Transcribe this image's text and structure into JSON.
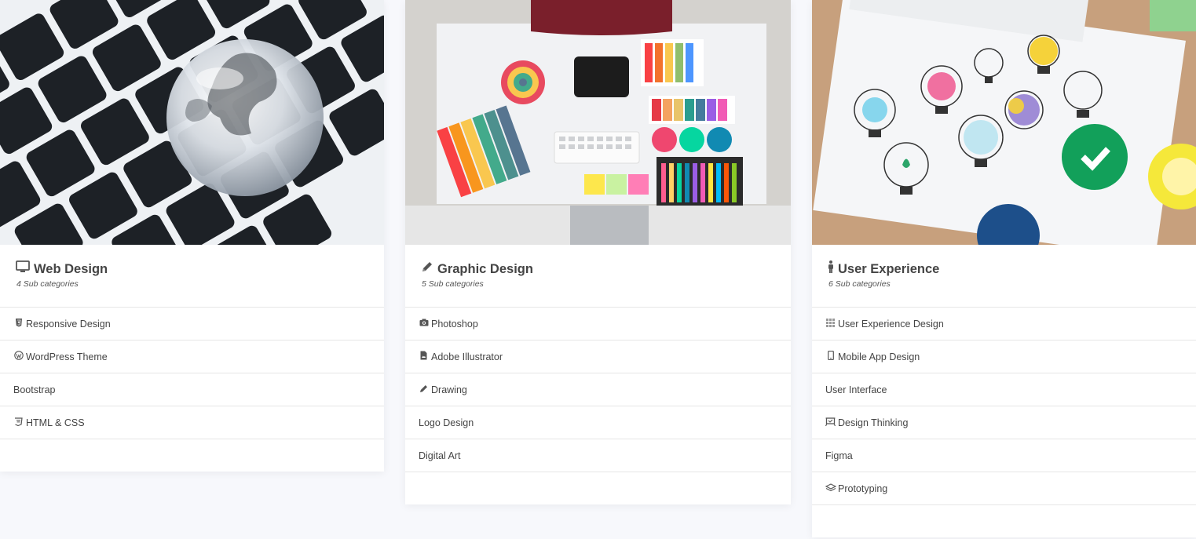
{
  "cards": [
    {
      "title": "Web Design",
      "icon": "monitor-icon",
      "subtitle": "4 Sub categories",
      "image": "keyboard-with-glass-globe",
      "items": [
        {
          "label": "Responsive Design",
          "icon": "html5-shield-icon"
        },
        {
          "label": "WordPress Theme",
          "icon": "wordpress-icon"
        },
        {
          "label": "Bootstrap",
          "icon": ""
        },
        {
          "label": "HTML & CSS",
          "icon": "css3-icon"
        }
      ]
    },
    {
      "title": "Graphic Design",
      "icon": "pencil-icon",
      "subtitle": "5 Sub categories",
      "image": "designer-desk-with-color-swatches",
      "items": [
        {
          "label": "Photoshop",
          "icon": "camera-icon"
        },
        {
          "label": "Adobe Illustrator",
          "icon": "file-image-icon"
        },
        {
          "label": "Drawing",
          "icon": "pencil-icon"
        },
        {
          "label": "Logo Design",
          "icon": ""
        },
        {
          "label": "Digital Art",
          "icon": ""
        }
      ]
    },
    {
      "title": "User Experience",
      "icon": "person-icon",
      "subtitle": "6 Sub categories",
      "image": "lightbulb-sketches-on-paper",
      "items": [
        {
          "label": "User Experience Design",
          "icon": "grid-icon"
        },
        {
          "label": "Mobile App Design",
          "icon": "mobile-icon"
        },
        {
          "label": "User Interface",
          "icon": ""
        },
        {
          "label": "Design Thinking",
          "icon": "easel-icon"
        },
        {
          "label": "Figma",
          "icon": ""
        },
        {
          "label": "Prototyping",
          "icon": "layers-icon"
        }
      ]
    }
  ]
}
